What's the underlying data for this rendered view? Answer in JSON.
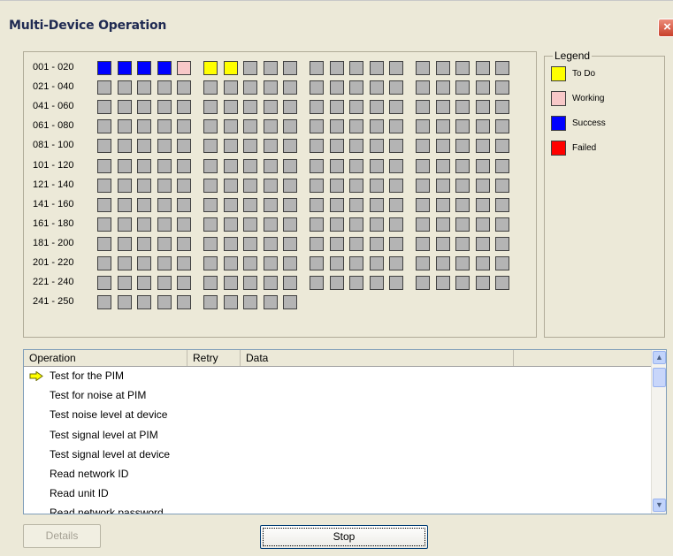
{
  "window": {
    "title": "Multi-Device Operation",
    "close_symbol": "×"
  },
  "colors": {
    "todo": "#ffff00",
    "working": "#f8c8c8",
    "success": "#0000ff",
    "failed": "#ff0000",
    "empty": "#b4b4b4"
  },
  "grid": {
    "rows": [
      {
        "label": "001 - 020",
        "count": 20
      },
      {
        "label": "021 - 040",
        "count": 20
      },
      {
        "label": "041 - 060",
        "count": 20
      },
      {
        "label": "061 - 080",
        "count": 20
      },
      {
        "label": "081 - 100",
        "count": 20
      },
      {
        "label": "101 - 120",
        "count": 20
      },
      {
        "label": "121 - 140",
        "count": 20
      },
      {
        "label": "141 - 160",
        "count": 20
      },
      {
        "label": "161 - 180",
        "count": 20
      },
      {
        "label": "181 - 200",
        "count": 20
      },
      {
        "label": "201 - 220",
        "count": 20
      },
      {
        "label": "221 - 240",
        "count": 20
      },
      {
        "label": "241 - 250",
        "count": 10
      }
    ],
    "device_status": [
      "success",
      "success",
      "success",
      "success",
      "working",
      "todo",
      "todo"
    ]
  },
  "legend": {
    "title": "Legend",
    "items": [
      {
        "label": "To Do",
        "status": "todo"
      },
      {
        "label": "Working",
        "status": "working"
      },
      {
        "label": "Success",
        "status": "success"
      },
      {
        "label": "Failed",
        "status": "failed"
      }
    ]
  },
  "operations": {
    "columns": [
      "Operation",
      "Retry",
      "Data"
    ],
    "rows": [
      {
        "operation": "Test for the PIM",
        "current": true
      },
      {
        "operation": "Test for noise at PIM",
        "current": false
      },
      {
        "operation": "Test noise level at device",
        "current": false
      },
      {
        "operation": "Test signal level at PIM",
        "current": false
      },
      {
        "operation": "Test signal level at device",
        "current": false
      },
      {
        "operation": "Read network ID",
        "current": false
      },
      {
        "operation": "Read unit ID",
        "current": false
      },
      {
        "operation": "Read network password",
        "current": false
      }
    ]
  },
  "buttons": {
    "details": "Details",
    "stop": "Stop"
  },
  "scrollbar": {
    "up_icon": "▲",
    "down_icon": "▼"
  }
}
